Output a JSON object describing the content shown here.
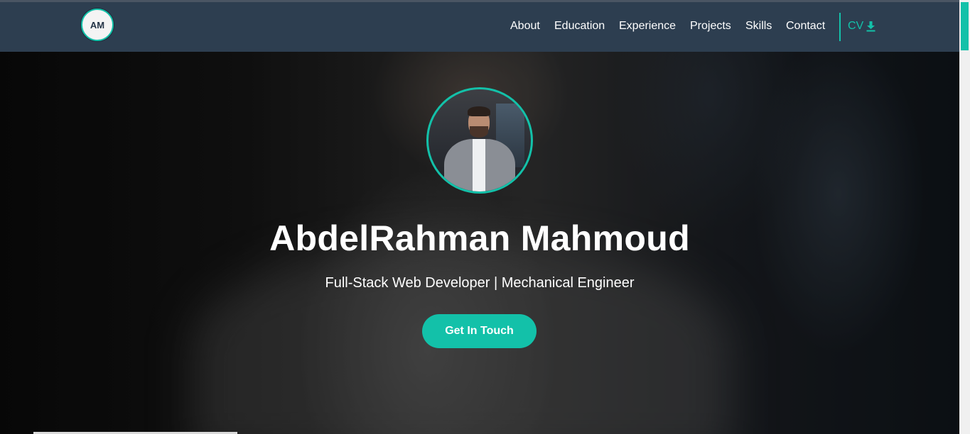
{
  "navbar": {
    "logo_text": "AM",
    "links": [
      {
        "label": "About"
      },
      {
        "label": "Education"
      },
      {
        "label": "Experience"
      },
      {
        "label": "Projects"
      },
      {
        "label": "Skills"
      },
      {
        "label": "Contact"
      }
    ],
    "cv_label": "CV",
    "cv_icon": "download-icon"
  },
  "hero": {
    "name": "AbdelRahman Mahmoud",
    "subtitle": "Full-Stack Web Developer | Mechanical Engineer",
    "cta_label": "Get In Touch"
  },
  "colors": {
    "accent": "#13c1a9",
    "navbar_bg": "#2d3e50",
    "text": "#ffffff"
  }
}
